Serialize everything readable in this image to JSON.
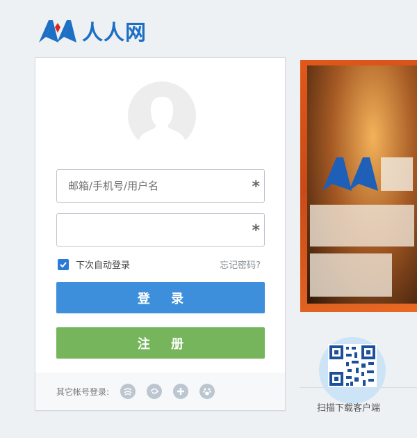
{
  "header": {
    "logo_text": "人人网"
  },
  "login": {
    "username_placeholder": "邮箱/手机号/用户名",
    "password_value": "",
    "required_mark": "*",
    "remember_label": "下次自动登录",
    "remember_checked": true,
    "forgot_link": "忘记密码?",
    "login_button": "登 录",
    "register_button": "注 册",
    "social_label": "其它帐号登录:",
    "social_icons": [
      "chinamobile-icon",
      "tianyi-icon",
      "360-icon",
      "baidu-icon"
    ]
  },
  "sidebar": {
    "qr_label": "扫描下载客户端"
  },
  "colors": {
    "brand_blue": "#1c6fc4",
    "login_button": "#3d8fdb",
    "register_button": "#76b55c",
    "banner_orange": "#e0581b"
  }
}
